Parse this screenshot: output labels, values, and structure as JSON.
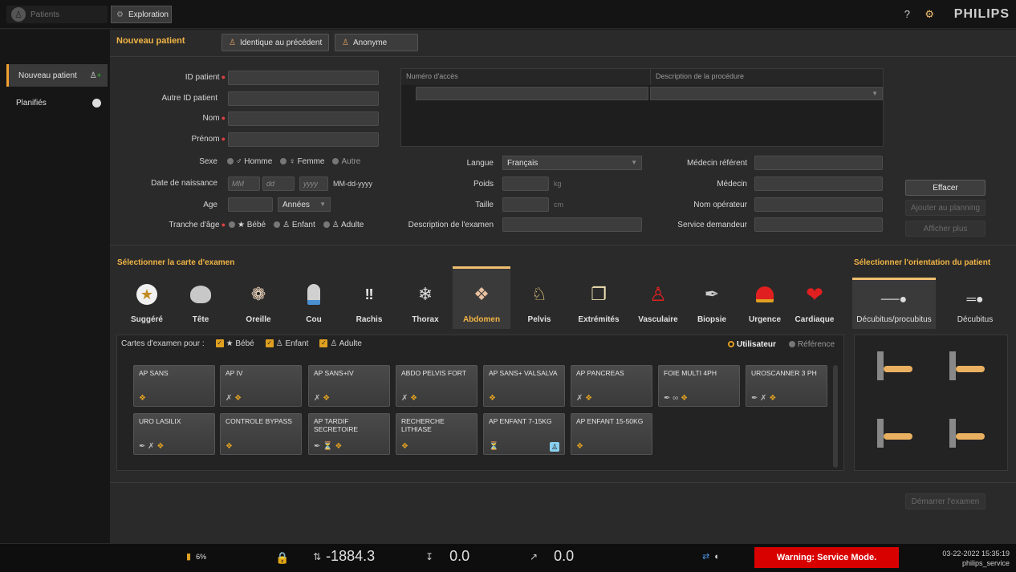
{
  "topbar": {
    "patients_tab": "Patients",
    "exploration_tab": "Exploration",
    "help_icon": "?",
    "brand": "PHILIPS"
  },
  "sidebar": {
    "items": [
      {
        "label": "Nouveau patient",
        "icon": "add-person-icon"
      },
      {
        "label": "Planifiés",
        "icon": "clock-icon"
      }
    ]
  },
  "patient": {
    "title": "Nouveau patient",
    "same_as_previous": "Identique au précédent",
    "anonymous": "Anonyme",
    "fields": {
      "id_label": "ID patient",
      "other_id_label": "Autre ID patient",
      "name_label": "Nom",
      "first_name_label": "Prénom",
      "sex_label": "Sexe",
      "sex_options": [
        "♂ Homme",
        "♀ Femme",
        "Autre"
      ],
      "dob_label": "Date de naissance",
      "dob_mm": "MM",
      "dob_dd": "dd",
      "dob_yyyy": "yyyy",
      "dob_format": "MM-dd-yyyy",
      "age_label": "Age",
      "age_unit": "Années",
      "age_range_label": "Tranche d'âge",
      "age_range_options": [
        "Bébé",
        "Enfant",
        "Adulte"
      ]
    },
    "table": {
      "col_access": "Numéro d'accès",
      "col_desc": "Description de la procédure"
    },
    "mid": {
      "language_label": "Langue",
      "language_value": "Français",
      "weight_label": "Poids",
      "weight_unit": "kg",
      "height_label": "Taille",
      "height_unit": "cm",
      "exam_desc_label": "Description de l'examen"
    },
    "right": {
      "ref_doctor_label": "Médecin référent",
      "doctor_label": "Médecin",
      "operator_label": "Nom opérateur",
      "service_label": "Service demandeur"
    },
    "buttons": {
      "clear": "Effacer",
      "add_planning": "Ajouter au planning",
      "show_more": "Afficher plus",
      "start_exam": "Démarrer l'examen"
    }
  },
  "exam_map": {
    "title": "Sélectionner la carte d'examen",
    "categories": [
      {
        "label": "Suggéré",
        "icon": "star-icon"
      },
      {
        "label": "Tête",
        "icon": "brain-icon"
      },
      {
        "label": "Oreille",
        "icon": "ear-icon"
      },
      {
        "label": "Cou",
        "icon": "neck-icon"
      },
      {
        "label": "Rachis",
        "icon": "spine-icon"
      },
      {
        "label": "Thorax",
        "icon": "lungs-icon"
      },
      {
        "label": "Abdomen",
        "icon": "abdomen-icon"
      },
      {
        "label": "Pelvis",
        "icon": "pelvis-icon"
      },
      {
        "label": "Extrémités",
        "icon": "knee-icon"
      },
      {
        "label": "Vasculaire",
        "icon": "vascular-icon"
      },
      {
        "label": "Biopsie",
        "icon": "needle-icon"
      },
      {
        "label": "Urgence",
        "icon": "siren-icon"
      },
      {
        "label": "Cardiaque",
        "icon": "heart-icon"
      }
    ],
    "filter_label": "Cartes d'examen pour :",
    "filters": [
      "Bébé",
      "Enfant",
      "Adulte"
    ],
    "source_user": "Utilisateur",
    "source_ref": "Référence",
    "cards": [
      {
        "name": "AP SANS",
        "icons": "c"
      },
      {
        "name": "AP IV",
        "icons": "nc"
      },
      {
        "name": "AP SANS+IV",
        "icons": "nc"
      },
      {
        "name": "ABDO PELVIS FORT",
        "icons": "nc"
      },
      {
        "name": "AP SANS+ VALSALVA",
        "icons": "c"
      },
      {
        "name": "AP PANCREAS",
        "icons": "nc"
      },
      {
        "name": "FOIE MULTI 4PH",
        "icons": "ngc"
      },
      {
        "name": "UROSCANNER 3 PH",
        "icons": "nnc"
      },
      {
        "name": "URO LASILIX",
        "icons": "nnc"
      },
      {
        "name": "CONTROLE BYPASS",
        "icons": "c"
      },
      {
        "name": "AP TARDIF SECRETOIRE",
        "icons": "nsc"
      },
      {
        "name": "RECHERCHE LITHIASE",
        "icons": "c"
      },
      {
        "name": "AP ENFANT 7-15KG",
        "icons": "s"
      },
      {
        "name": "AP ENFANT 15-50KG",
        "icons": "c"
      }
    ]
  },
  "orientation": {
    "title": "Sélectionner l'orientation du patient",
    "tabs": [
      "Décubitus/procubitus",
      "Décubitus"
    ]
  },
  "status": {
    "battery": "6%",
    "position": "-1884.3",
    "tilt": "0.0",
    "angle": "0.0",
    "warning": "Warning: Service Mode.",
    "datetime": "03-22-2022 15:35:19",
    "user": "philips_service"
  }
}
